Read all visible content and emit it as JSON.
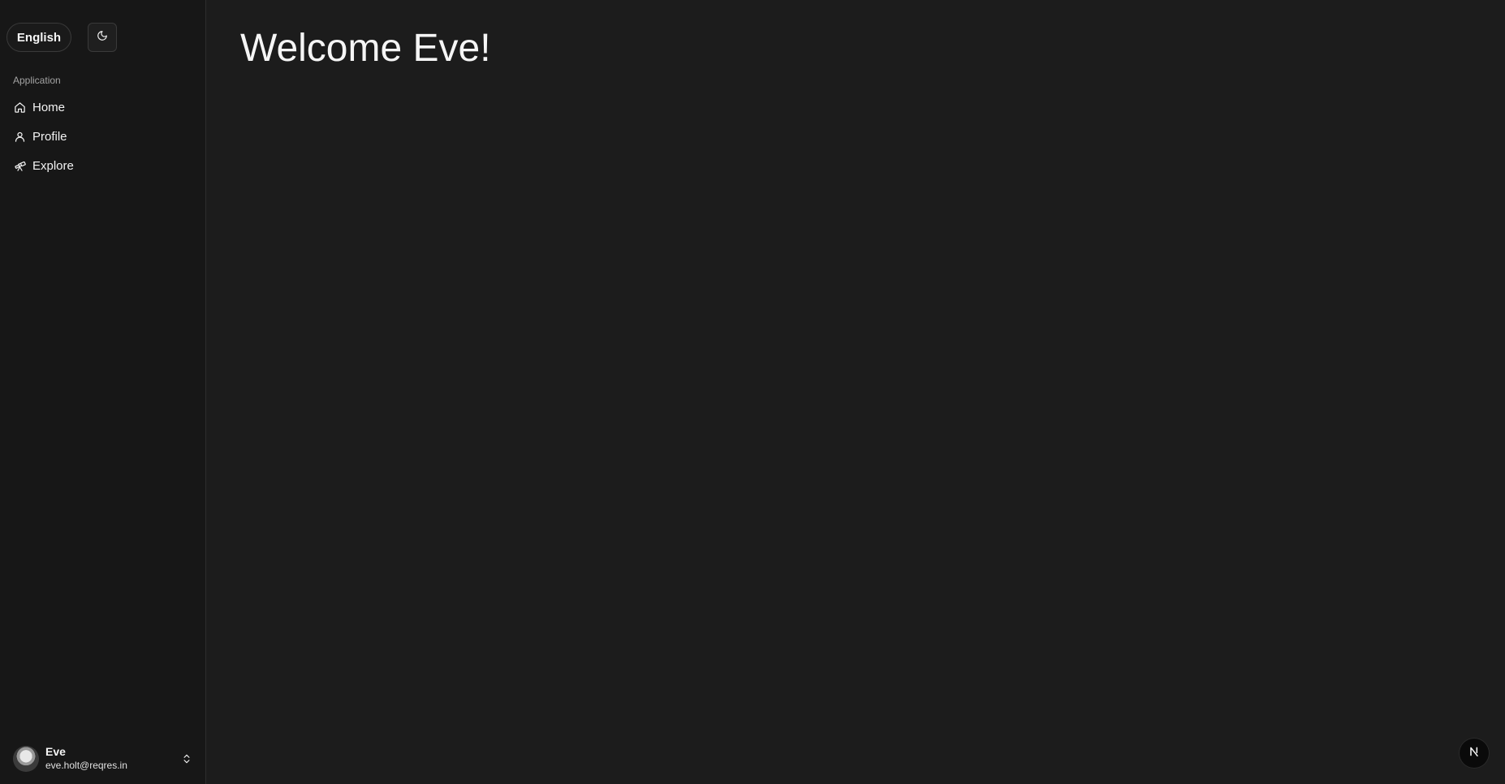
{
  "sidebar": {
    "language_button_label": "English",
    "theme_toggle_icon": "moon-icon",
    "group_label": "Application",
    "items": [
      {
        "label": "Home",
        "icon": "home-icon"
      },
      {
        "label": "Profile",
        "icon": "user-icon"
      },
      {
        "label": "Explore",
        "icon": "telescope-icon"
      }
    ],
    "user": {
      "name": "Eve",
      "email": "eve.holt@reqres.in",
      "avatar": "avatar-photo",
      "menu_icon": "chevrons-up-down-icon"
    }
  },
  "main": {
    "title": "Welcome Eve!"
  },
  "floating": {
    "badge_icon": "next-logo-icon"
  },
  "colors": {
    "background": "#1c1c1c",
    "sidebar_background": "#171717",
    "text": "#f2f2f2",
    "muted_text": "#a3a3a3",
    "border": "#2e2e2e"
  }
}
